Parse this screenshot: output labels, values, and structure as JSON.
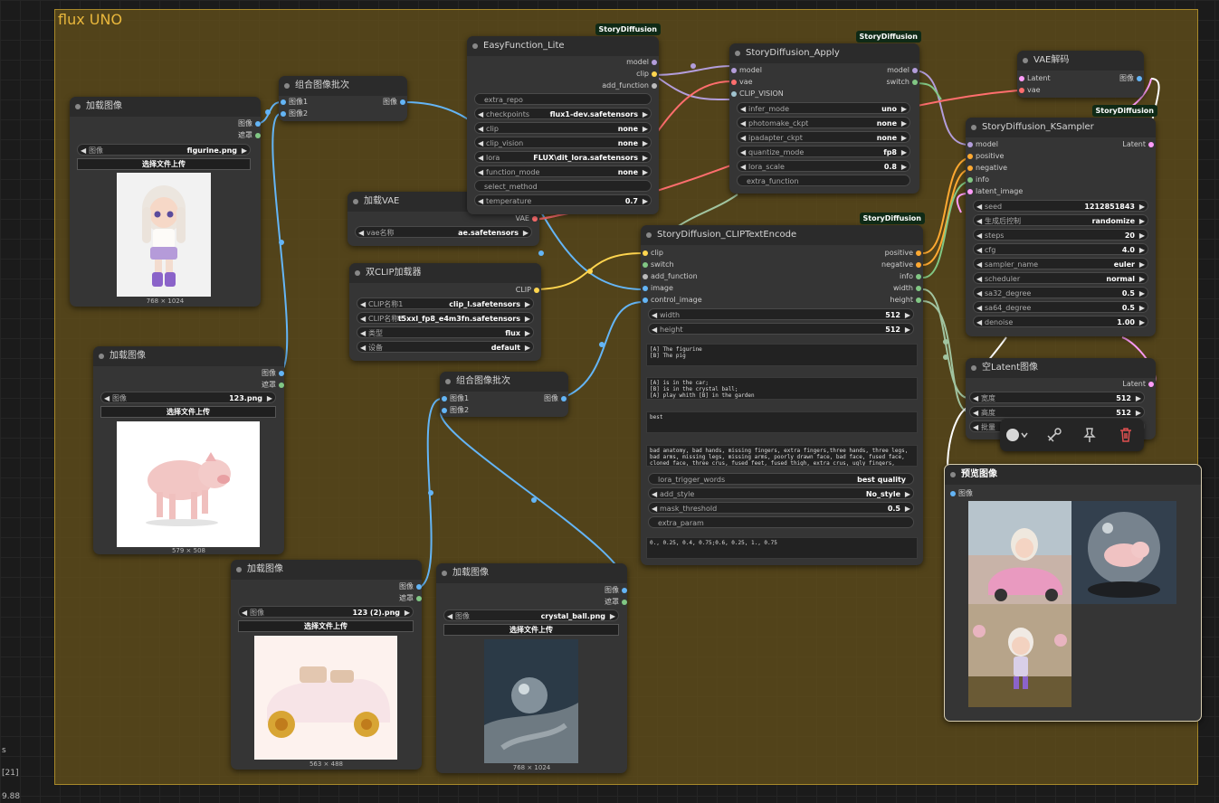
{
  "group": {
    "title": "flux UNO"
  },
  "corner": {
    "t1": "s",
    "t2": "[21]",
    "t3": "9.88"
  },
  "badge": "StoryDiffusion",
  "load1": {
    "title": "加载图像",
    "out_image": "图像",
    "out_mask": "遮罩",
    "w_label": "图像",
    "w_value": "figurine.png",
    "upload": "选择文件上传",
    "dims": "768 × 1024"
  },
  "load2": {
    "title": "加载图像",
    "out_image": "图像",
    "out_mask": "遮罩",
    "w_label": "图像",
    "w_value": "123.png",
    "upload": "选择文件上传",
    "dims": "579 × 508"
  },
  "load3": {
    "title": "加载图像",
    "out_image": "图像",
    "out_mask": "遮罩",
    "w_label": "图像",
    "w_value": "123 (2).png",
    "upload": "选择文件上传",
    "dims": "563 × 488"
  },
  "load4": {
    "title": "加载图像",
    "out_image": "图像",
    "out_mask": "遮罩",
    "w_label": "图像",
    "w_value": "crystal_ball.png",
    "upload": "选择文件上传",
    "dims": "768 × 1024"
  },
  "batch1": {
    "title": "组合图像批次",
    "in1": "图像1",
    "in2": "图像2",
    "out": "图像"
  },
  "batch2": {
    "title": "组合图像批次",
    "in1": "图像1",
    "in2": "图像2",
    "out": "图像"
  },
  "vaeload": {
    "title": "加载VAE",
    "out": "VAE",
    "w_label": "vae名称",
    "w_value": "ae.safetensors"
  },
  "dualclip": {
    "title": "双CLIP加载器",
    "out": "CLIP",
    "widgets": [
      {
        "l": "CLIP名称1",
        "v": "clip_l.safetensors"
      },
      {
        "l": "CLIP名称2",
        "v": "t5xxl_fp8_e4m3fn.safetensors"
      },
      {
        "l": "类型",
        "v": "flux"
      },
      {
        "l": "设备",
        "v": "default"
      }
    ]
  },
  "easy": {
    "title": "EasyFunction_Lite",
    "outs": [
      "model",
      "clip",
      "add_function"
    ],
    "widgets": [
      {
        "l": "extra_repo",
        "v": "",
        "plain": true
      },
      {
        "l": "checkpoints",
        "v": "flux1-dev.safetensors"
      },
      {
        "l": "clip",
        "v": "none"
      },
      {
        "l": "clip_vision",
        "v": "none"
      },
      {
        "l": "lora",
        "v": "FLUX\\dit_lora.safetensors"
      },
      {
        "l": "function_mode",
        "v": "none"
      },
      {
        "l": "select_method",
        "v": "",
        "plain": true
      },
      {
        "l": "temperature",
        "v": "0.7"
      }
    ]
  },
  "apply": {
    "title": "StoryDiffusion_Apply",
    "ins": [
      "model",
      "vae",
      "CLIP_VISION"
    ],
    "outs": [
      "model",
      "switch"
    ],
    "widgets": [
      {
        "l": "infer_mode",
        "v": "uno"
      },
      {
        "l": "photomake_ckpt",
        "v": "none"
      },
      {
        "l": "ipadapter_ckpt",
        "v": "none"
      },
      {
        "l": "quantize_mode",
        "v": "fp8"
      },
      {
        "l": "lora_scale",
        "v": "0.8"
      },
      {
        "l": "extra_function",
        "v": "",
        "plain": true
      }
    ]
  },
  "clipenc": {
    "title": "StoryDiffusion_CLIPTextEncode",
    "ins": [
      "clip",
      "switch",
      "add_function",
      "image",
      "control_image"
    ],
    "outs": [
      "positive",
      "negative",
      "info",
      "width",
      "height"
    ],
    "widgets": [
      {
        "l": "width",
        "v": "512"
      },
      {
        "l": "height",
        "v": "512"
      }
    ],
    "text1": "[A] The figurine\n[B] The pig",
    "text2": "[A] is in the car;\n[B] is in the crystal ball;\n[A] play whith [B] in the garden",
    "text3": "best",
    "text4": "bad anatomy, bad hands, missing fingers, extra fingers,three hands, three legs, bad arms, missing legs, missing arms, poorly drawn face, bad face, fused face, cloned face, three crus, fused feet, fused thigh, extra crus, ugly fingers, horn,amputation,",
    "widgets2": [
      {
        "l": "lora_trigger_words",
        "v": "best quality",
        "plain": true
      },
      {
        "l": "add_style",
        "v": "No_style"
      },
      {
        "l": "mask_threshold",
        "v": "0.5"
      },
      {
        "l": "extra_param",
        "v": "",
        "plain": true
      }
    ],
    "text5": "0., 0.25, 0.4, 0.75;0.6, 0.25, 1., 0.75"
  },
  "vaedec": {
    "title": "VAE解码",
    "ins": [
      "Latent",
      "vae"
    ],
    "out": "图像"
  },
  "ksampler": {
    "title": "StoryDiffusion_KSampler",
    "ins": [
      "model",
      "positive",
      "negative",
      "info",
      "latent_image"
    ],
    "out": "Latent",
    "widgets": [
      {
        "l": "seed",
        "v": "1212851843"
      },
      {
        "l": "生成后控制",
        "v": "randomize"
      },
      {
        "l": "steps",
        "v": "20"
      },
      {
        "l": "cfg",
        "v": "4.0"
      },
      {
        "l": "sampler_name",
        "v": "euler"
      },
      {
        "l": "scheduler",
        "v": "normal"
      },
      {
        "l": "sa32_degree",
        "v": "0.5"
      },
      {
        "l": "sa64_degree",
        "v": "0.5"
      },
      {
        "l": "denoise",
        "v": "1.00"
      }
    ]
  },
  "emptylat": {
    "title": "空Latent图像",
    "out": "Latent",
    "widgets": [
      {
        "l": "宽度",
        "v": "512"
      },
      {
        "l": "高度",
        "v": "512"
      },
      {
        "l": "批量",
        "v": ""
      }
    ]
  },
  "preview": {
    "title": "预览图像",
    "in": "图像"
  },
  "colors": {
    "image": "#64b5f6",
    "mask": "#81c784",
    "model": "#b39ddb",
    "clip": "#ffd54f",
    "vae": "#ff6e6e",
    "latent": "#ff9cf9",
    "cond": "#ffa931",
    "vision": "#a1c4d0"
  },
  "toolbar": {
    "icons": [
      "color-circle-icon",
      "chevron-down-icon",
      "bypass-icon",
      "pin-icon",
      "trash-icon"
    ]
  }
}
